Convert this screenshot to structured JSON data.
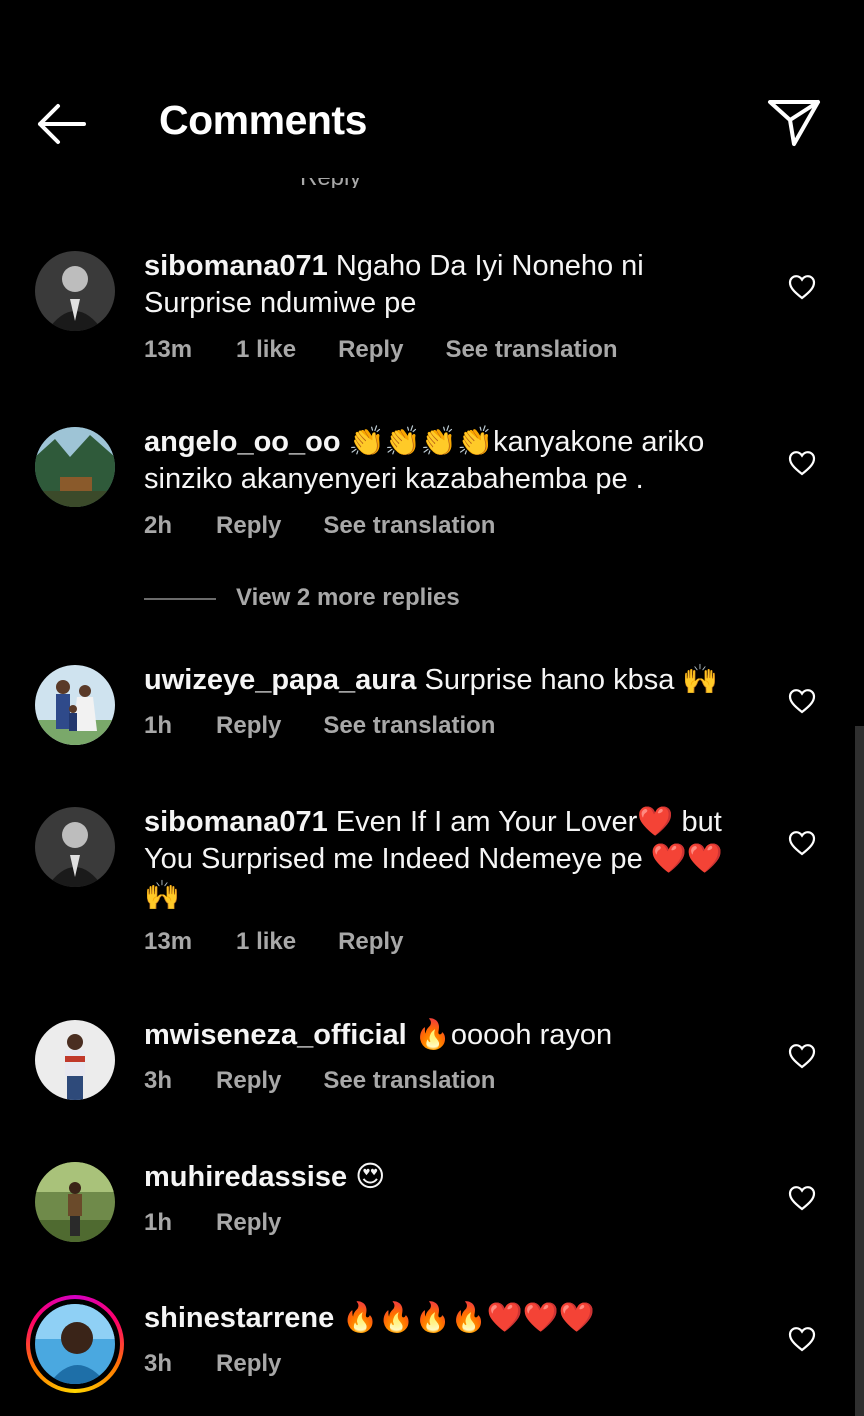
{
  "header": {
    "title": "Comments",
    "back_icon": "arrow-left-icon",
    "send_icon": "paper-plane-icon"
  },
  "peek_text": "Reply",
  "comments": [
    {
      "username": "sibomana071",
      "text": "Ngaho Da Iyi Noneho ni Surprise ndumiwe pe",
      "time": "13m",
      "likes": "1 like",
      "reply": "Reply",
      "translate": "See translation"
    },
    {
      "username": "angelo_oo_oo",
      "text": "👏👏👏👏kanyakone ariko sinziko akanyenyeri kazabahemba pe .",
      "time": "2h",
      "reply": "Reply",
      "translate": "See translation"
    },
    {
      "username": "uwizeye_papa_aura",
      "text": "Surprise hano kbsa 🙌",
      "time": "1h",
      "reply": "Reply",
      "translate": "See translation"
    },
    {
      "username": "sibomana071",
      "text": "Even If I am Your Lover❤️ but You Surprised me Indeed Ndemeye pe ❤️❤️🙌",
      "time": "13m",
      "likes": "1 like",
      "reply": "Reply"
    },
    {
      "username": "mwiseneza_official",
      "text": "🔥ooooh rayon",
      "time": "3h",
      "reply": "Reply",
      "translate": "See translation"
    },
    {
      "username": "muhiredassise",
      "text": "😍",
      "time": "1h",
      "reply": "Reply"
    },
    {
      "username": "shinestarrene",
      "text": "🔥🔥🔥🔥❤️❤️❤️",
      "time": "3h",
      "reply": "Reply"
    }
  ],
  "view_more_replies": "View 2 more replies",
  "colors": {
    "background": "#000000",
    "text": "#f5f5f5",
    "muted": "#a8a8a8"
  }
}
